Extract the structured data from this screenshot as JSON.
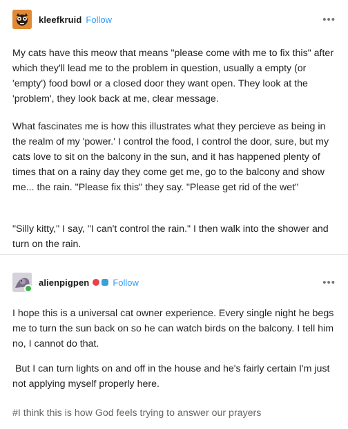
{
  "post1": {
    "username": "kleefkruid",
    "follow_label": "Follow",
    "more_label": "•••",
    "paragraphs": [
      "My cats have this meow that means \"please come with me to fix this\" after which they'll lead me to the problem in question, usually a empty (or 'empty') food bowl or a closed door they want open. They look at the 'problem', they look back at me, clear message.",
      "What fascinates me is how this illustrates what they percieve as being in the realm of my 'power.' I control the food, I control the door, sure, but my cats love to sit on the balcony in the sun, and it has happened plenty of times that on a rainy day they come get me, go to the balcony and show me... the rain. \"Please fix this\" they say. \"Please get rid of the wet\"",
      "\"Silly kitty,\" I say, \"I can't control the rain.\" I then walk into the shower and turn on the rain."
    ]
  },
  "post2": {
    "username": "alienpigpen",
    "follow_label": "Follow",
    "more_label": "•••",
    "paragraphs": [
      "I hope this is a universal cat owner experience. Every single night he begs me to turn the sun back on so he can watch birds on the balcony. I tell him no, I cannot do that.",
      " But I can turn lights on and off in the house and he's fairly certain I'm just not applying myself properly here."
    ],
    "tag": "#I think this is how God feels trying to answer our prayers"
  },
  "colors": {
    "follow": "#2f9bff",
    "tag": "#666666",
    "online_dot": "#3db34a"
  }
}
